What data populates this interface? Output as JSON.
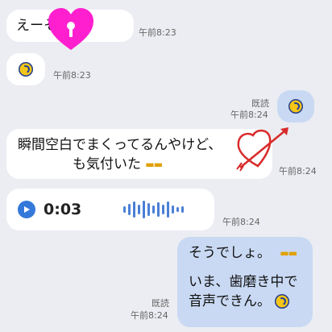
{
  "messages": {
    "m1": {
      "text": "えーそれも？",
      "time": "午前8:23"
    },
    "m2": {
      "time": "午前8:23"
    },
    "m3": {
      "read": "既読",
      "time": "午前8:24"
    },
    "m4": {
      "line1": "瞬間空白でまくってるんやけど、",
      "line2": "も気付いた",
      "time": "午前8:24"
    },
    "m5": {
      "duration": "0:03",
      "time": "午前8:24"
    },
    "m6": {
      "line1": "そうでしょ。",
      "line2": "いま、歯磨き中で",
      "line3": "音声できん。",
      "read": "既読",
      "time": "午前8:24"
    }
  },
  "colors": {
    "background": "#ebedf2",
    "incoming_bubble": "#ffffff",
    "outgoing_bubble": "#c9d9f3",
    "play_button": "#3478d9",
    "waveform": "#4a7fd6",
    "heart_sticker": "#ff1fcf",
    "arrow_heart": "#d92a2a"
  },
  "icons": {
    "sticker_emoji": "laughing-emoji",
    "grin_emoji": "grinning-emoji",
    "play": "play-icon",
    "lock_heart": "heart-lock-sticker",
    "arrow_heart": "heart-arrow-doodle"
  }
}
